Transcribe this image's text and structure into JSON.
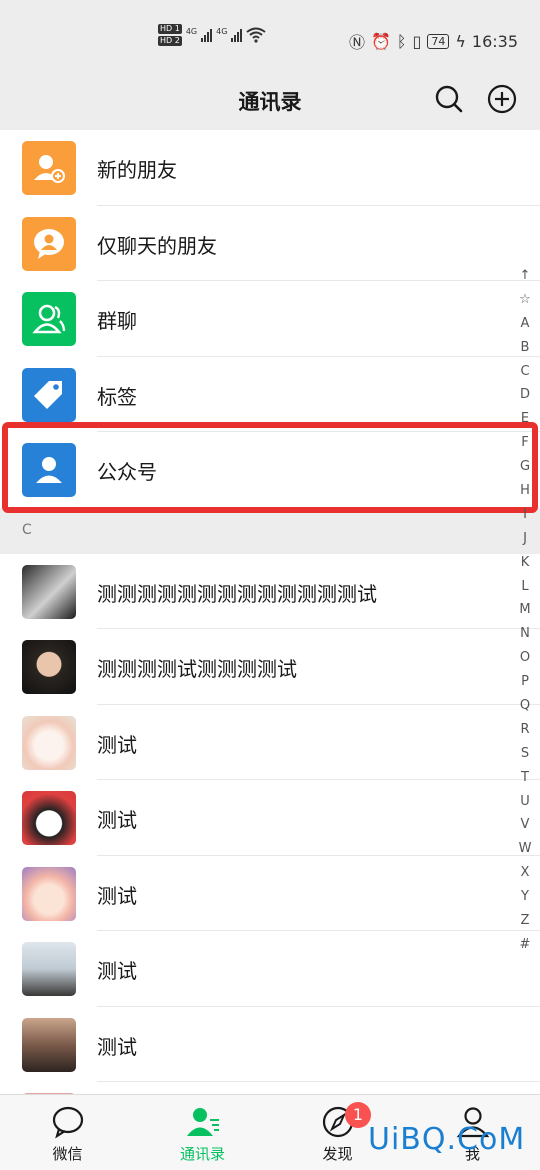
{
  "status_bar": {
    "hd1": "HD 1",
    "hd2": "HD 2",
    "net1": "4G",
    "net2": "4G",
    "battery": "74",
    "time": "16:35"
  },
  "header": {
    "title": "通讯录"
  },
  "function_items": [
    {
      "label": "新的朋友",
      "icon": "add-friend-icon",
      "color": "#fa9d3b"
    },
    {
      "label": "仅聊天的朋友",
      "icon": "chat-friend-icon",
      "color": "#fa9d3b"
    },
    {
      "label": "群聊",
      "icon": "group-chat-icon",
      "color": "#07c160"
    },
    {
      "label": "标签",
      "icon": "tag-icon",
      "color": "#2782d7"
    },
    {
      "label": "公众号",
      "icon": "official-account-icon",
      "color": "#2782d7"
    }
  ],
  "section_letter": "C",
  "contacts": [
    {
      "name": "测测测测测测测测测测测测测试"
    },
    {
      "name": "测测测测试测测测测试"
    },
    {
      "name": "测试"
    },
    {
      "name": "测试"
    },
    {
      "name": "测试"
    },
    {
      "name": "测试"
    },
    {
      "name": "测试"
    }
  ],
  "index_bar": [
    "↑",
    "☆",
    "A",
    "B",
    "C",
    "D",
    "E",
    "F",
    "G",
    "H",
    "I",
    "J",
    "K",
    "L",
    "M",
    "N",
    "O",
    "P",
    "Q",
    "R",
    "S",
    "T",
    "U",
    "V",
    "W",
    "X",
    "Y",
    "Z",
    "#"
  ],
  "tabs": [
    {
      "label": "微信",
      "icon": "chat-bubble-icon"
    },
    {
      "label": "通讯录",
      "icon": "contacts-icon",
      "active": true
    },
    {
      "label": "发现",
      "icon": "compass-icon",
      "badge": "1"
    },
    {
      "label": "我",
      "icon": "person-icon"
    }
  ],
  "watermark": "UiBQ.CoM",
  "colors": {
    "accent": "#07c160",
    "highlight": "#e8302f",
    "badge": "#fa5151"
  }
}
